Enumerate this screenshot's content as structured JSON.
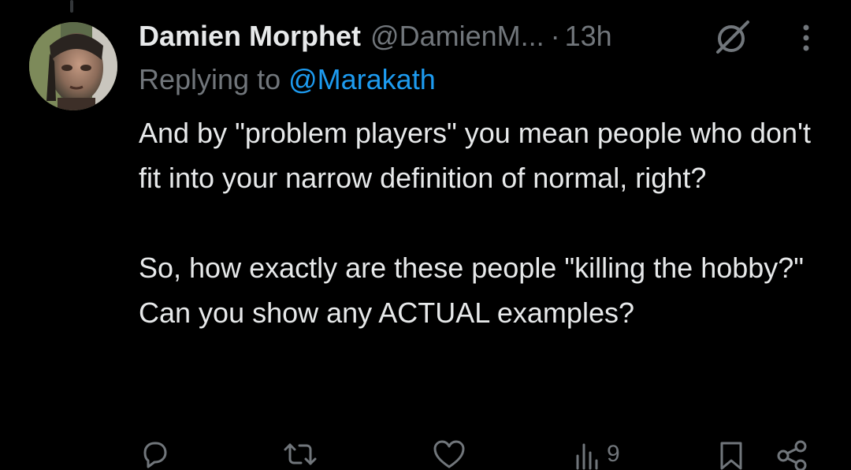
{
  "tweet": {
    "author": {
      "display_name": "Damien Morphet",
      "handle": "@DamienM...",
      "avatar_icon": "profile-photo"
    },
    "separator": "·",
    "time": "13h",
    "reply": {
      "prefix": "Replying to ",
      "handle": "@Marakath"
    },
    "paragraphs": [
      "And by \"problem players\" you mean people who don't fit into your narrow definition of normal, right?",
      "So, how exactly are these people \"killing the hobby?\" Can you show any ACTUAL examples?"
    ]
  },
  "actions": {
    "reply_icon": "reply-icon",
    "retweet_icon": "retweet-icon",
    "like_icon": "heart-icon",
    "views_icon": "views-icon",
    "views_count": "9",
    "bookmark_icon": "bookmark-icon",
    "share_icon": "share-icon"
  },
  "colors": {
    "background": "#000000",
    "text": "#e7e9ea",
    "muted": "#71767b",
    "link": "#1d9bf0"
  }
}
